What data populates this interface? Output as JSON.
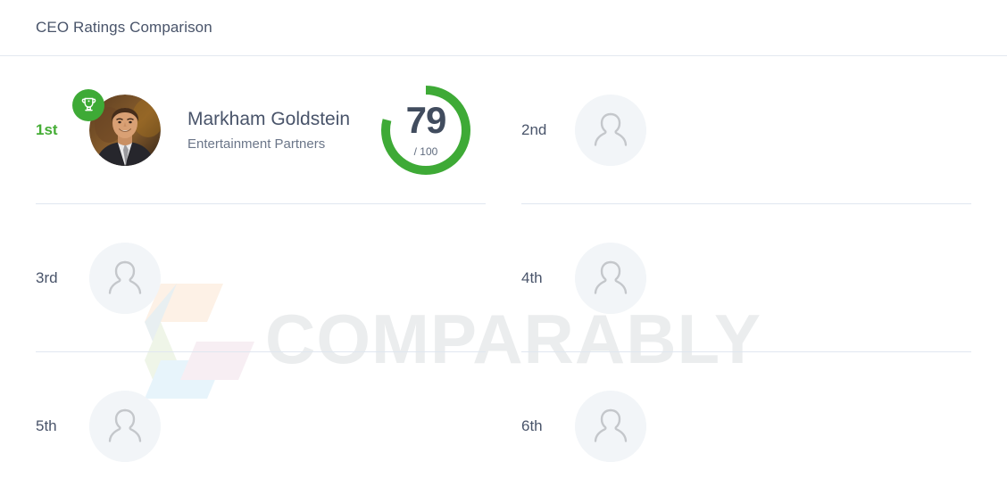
{
  "header": {
    "title": "CEO Ratings Comparison"
  },
  "colors": {
    "accent_green": "#3eaa36",
    "rank_first_green": "#45ad35",
    "text_slate": "#49546a",
    "divider": "#e0e7f0",
    "avatar_placeholder_bg": "#f2f5f8",
    "avatar_placeholder_fg": "#c4c7cb",
    "watermark_text": "#ebedee"
  },
  "watermark": {
    "text": "COMPARABLY",
    "mark_name": "comparably-hexagon-logo"
  },
  "entries": [
    {
      "rank": "1st",
      "is_first": true,
      "has_photo": true,
      "badge": "trophy-icon",
      "name": "Markham Goldstein",
      "company": "Entertainment Partners",
      "score": "79",
      "score_denominator": "/ 100",
      "score_percent": 79
    },
    {
      "rank": "2nd",
      "is_first": false,
      "has_photo": false,
      "name": "",
      "company": "",
      "score": "",
      "score_denominator": "",
      "score_percent": 0
    },
    {
      "rank": "3rd",
      "is_first": false,
      "has_photo": false,
      "name": "",
      "company": "",
      "score": "",
      "score_denominator": "",
      "score_percent": 0
    },
    {
      "rank": "4th",
      "is_first": false,
      "has_photo": false,
      "name": "",
      "company": "",
      "score": "",
      "score_denominator": "",
      "score_percent": 0
    },
    {
      "rank": "5th",
      "is_first": false,
      "has_photo": false,
      "name": "",
      "company": "",
      "score": "",
      "score_denominator": "",
      "score_percent": 0
    },
    {
      "rank": "6th",
      "is_first": false,
      "has_photo": false,
      "name": "",
      "company": "",
      "score": "",
      "score_denominator": "",
      "score_percent": 0
    }
  ]
}
